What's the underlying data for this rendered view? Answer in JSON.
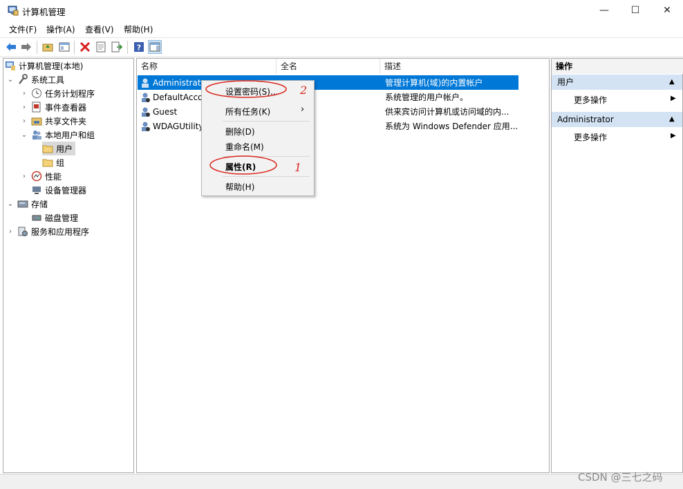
{
  "window": {
    "title": "计算机管理",
    "minimize": "—",
    "maximize": "☐",
    "close": "✕"
  },
  "menubar": [
    "文件(F)",
    "操作(A)",
    "查看(V)",
    "帮助(H)"
  ],
  "tree": {
    "root": "计算机管理(本地)",
    "system_tools": "系统工具",
    "task_scheduler": "任务计划程序",
    "event_viewer": "事件查看器",
    "shared_folders": "共享文件夹",
    "local_users_groups": "本地用户和组",
    "users": "用户",
    "groups": "组",
    "performance": "性能",
    "device_manager": "设备管理器",
    "storage": "存储",
    "disk_management": "磁盘管理",
    "services_apps": "服务和应用程序"
  },
  "list": {
    "columns": [
      "名称",
      "全名",
      "描述"
    ],
    "rows": [
      {
        "name": "Administrator",
        "fullname": "",
        "desc": "管理计算机(域)的内置帐户",
        "selected": true
      },
      {
        "name": "DefaultAccount",
        "fullname": "",
        "desc": "系统管理的用户帐户。",
        "selected": false
      },
      {
        "name": "Guest",
        "fullname": "",
        "desc": "供来宾访问计算机或访问域的内...",
        "selected": false
      },
      {
        "name": "WDAGUtilityAccount",
        "fullname": "",
        "desc": "系统为 Windows Defender 应用...",
        "selected": false
      }
    ]
  },
  "context_menu": {
    "set_password": "设置密码(S)...",
    "all_tasks": "所有任务(K)",
    "delete": "删除(D)",
    "rename": "重命名(M)",
    "properties": "属性(R)",
    "help": "帮助(H)",
    "annotation_1": "1",
    "annotation_2": "2",
    "annotation_color": "#d9261c"
  },
  "actions_pane": {
    "header": "操作",
    "section1": "用户",
    "more1": "更多操作",
    "section2": "Administrator",
    "more2": "更多操作"
  },
  "watermark": "CSDN @三七之码",
  "colors": {
    "selection": "#0078d7",
    "section_header": "#d3e3f4"
  }
}
